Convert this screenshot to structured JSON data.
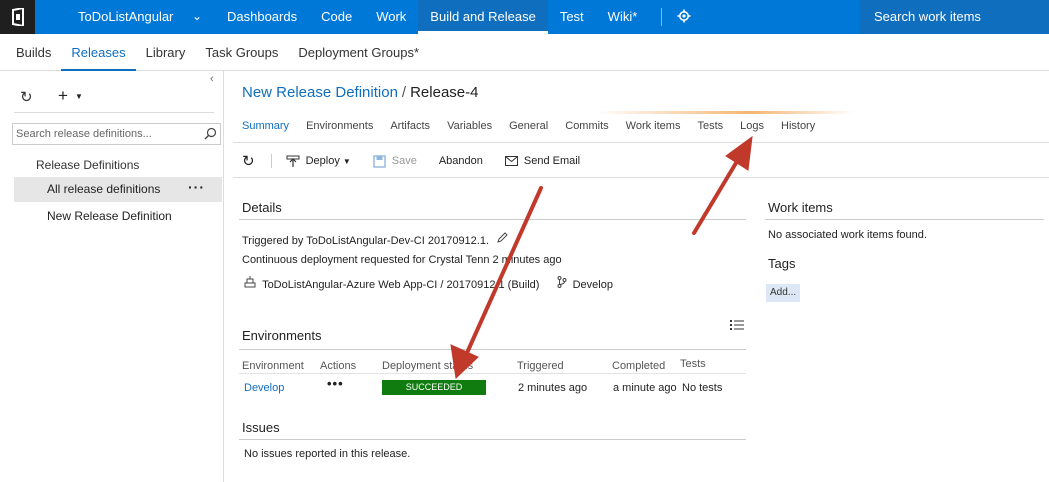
{
  "topbar": {
    "project": "ToDoListAngular",
    "nav": [
      "Dashboards",
      "Code",
      "Work",
      "Build and Release",
      "Test",
      "Wiki*"
    ],
    "active_nav": "Build and Release",
    "search": "Search work items"
  },
  "subnav": {
    "items": [
      "Builds",
      "Releases",
      "Library",
      "Task Groups",
      "Deployment Groups*"
    ],
    "active": "Releases"
  },
  "left": {
    "search_placeholder": "Search release definitions...",
    "tree_header": "Release Definitions",
    "selected": "All release definitions",
    "item2": "New Release Definition"
  },
  "breadcrumb": {
    "definition": "New Release Definition",
    "separator": "/",
    "release": "Release-4"
  },
  "tabs": [
    "Summary",
    "Environments",
    "Artifacts",
    "Variables",
    "General",
    "Commits",
    "Work items",
    "Tests",
    "Logs",
    "History"
  ],
  "active_tab": "Summary",
  "toolbar": {
    "deploy": "Deploy",
    "save": "Save",
    "abandon": "Abandon",
    "send_email": "Send Email"
  },
  "details": {
    "title": "Details",
    "triggered": "Triggered by ToDoListAngular-Dev-CI 20170912.1.",
    "continuous": "Continuous deployment requested for Crystal Tenn 2 minutes ago",
    "artifact": "ToDoListAngular-Azure Web App-CI / 20170912.1 (Build)",
    "branch": "Develop"
  },
  "environments": {
    "title": "Environments",
    "headers": [
      "Environment",
      "Actions",
      "Deployment status",
      "Triggered",
      "Completed",
      "Tests"
    ],
    "row": {
      "environment": "Develop",
      "actions": "•••",
      "status": "SUCCEEDED",
      "triggered": "2 minutes ago",
      "completed": "a minute ago",
      "tests": "No tests"
    }
  },
  "issues": {
    "title": "Issues",
    "text": "No issues reported in this release."
  },
  "work_items": {
    "title": "Work items",
    "text": "No associated work items found."
  },
  "tags": {
    "title": "Tags",
    "add": "Add..."
  },
  "colors": {
    "accent": "#0078d7",
    "success": "#107c10",
    "annotation_arrow": "#c0392b"
  }
}
